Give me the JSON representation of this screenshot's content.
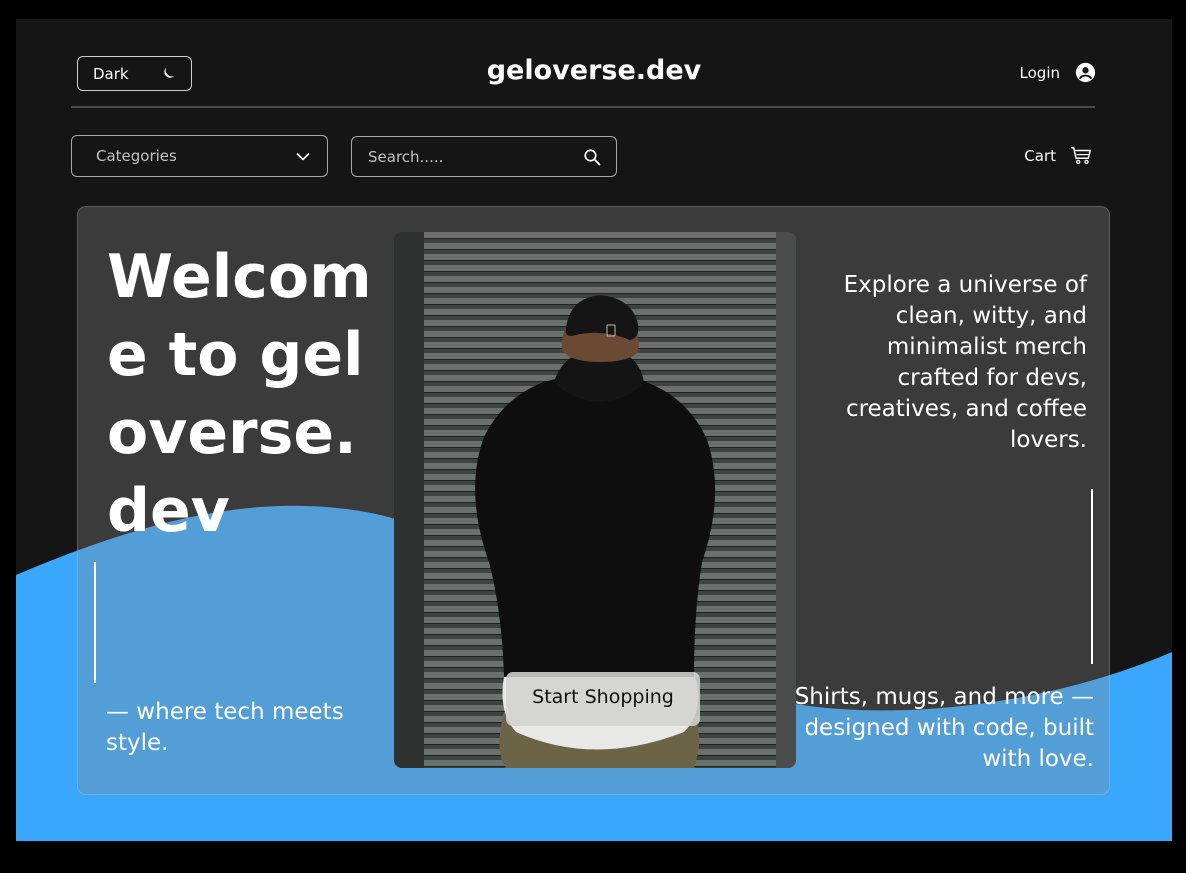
{
  "theme": {
    "label": "Dark",
    "icon": "moon-icon"
  },
  "brand": {
    "title": "geloverse.dev"
  },
  "account": {
    "login_label": "Login",
    "icon": "user-circle-icon"
  },
  "categories": {
    "label": "Categories",
    "icon": "chevron-down-icon"
  },
  "search": {
    "placeholder": "Search.....",
    "value": "",
    "icon": "search-icon"
  },
  "cart": {
    "label": "Cart",
    "icon": "cart-icon"
  },
  "hero": {
    "title": "Welcome to geloverse.dev",
    "tagline": "— where tech meets style.",
    "description": "Explore a universe of clean, witty, and minimalist merch crafted for devs, creatives, and coffee lovers.",
    "subtext": "Shirts, mugs, and more — designed with code, built with love.",
    "cta_label": "Start Shopping"
  },
  "colors": {
    "accent": "#3aa7fc",
    "background": "#151515",
    "panel": "#4a4a4a"
  }
}
